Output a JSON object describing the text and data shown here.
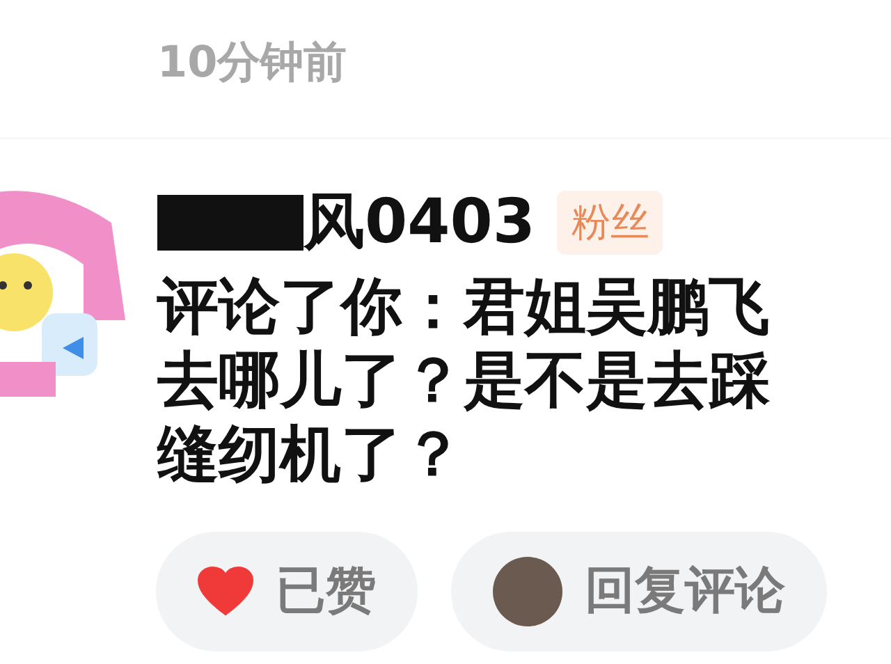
{
  "time": "10分钟前",
  "notification": {
    "username": {
      "redacted": true,
      "text": "风0403"
    },
    "badge": "粉丝",
    "message": "评论了你：君姐吴鹏飞去哪儿了？是不是去踩缝纫机了？"
  },
  "actions": [
    {
      "kind": "like",
      "label": "已赞",
      "liked": true
    },
    {
      "kind": "reply",
      "label": "回复评论"
    }
  ]
}
